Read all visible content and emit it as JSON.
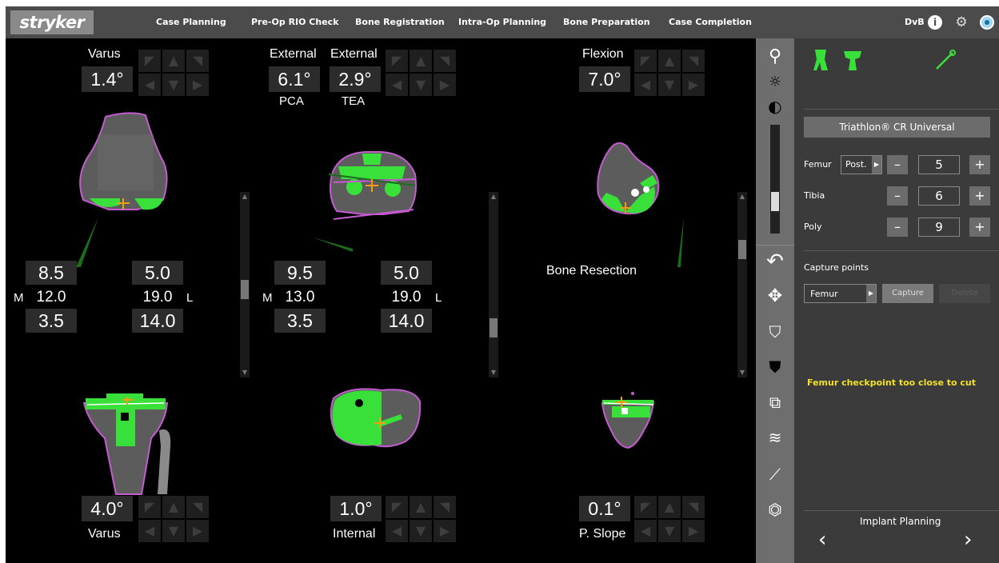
{
  "topbar": {
    "logo": "stryker",
    "tabs": [
      "Case Planning",
      "Pre-Op RIO Check",
      "Bone Registration",
      "Intra-Op Planning",
      "Bone Preparation",
      "Case Completion"
    ],
    "user": "DvB",
    "info_icon": "info-icon",
    "settings_icon": "gear-icon",
    "camera_icon": "camera-icon"
  },
  "views": {
    "top_left": {
      "label": "Varus",
      "value": "1.4°"
    },
    "top_mid": {
      "label_a": "External",
      "value_a": "6.1°",
      "sub_a": "PCA",
      "label_b": "External",
      "value_b": "2.9°",
      "sub_b": "TEA"
    },
    "top_right": {
      "label": "Flexion",
      "value": "7.0°"
    },
    "bottom_left": {
      "label": "Varus",
      "value": "4.0°"
    },
    "bottom_mid": {
      "label": "Internal",
      "value": "1.0°"
    },
    "bottom_right": {
      "label": "P. Slope",
      "value": "0.1°"
    },
    "bone_resection_label": "Bone Resection"
  },
  "gaps": {
    "left": {
      "m_top": "8.5",
      "m_mid": "12.0",
      "m_bot": "3.5",
      "l_top": "5.0",
      "l_mid": "19.0",
      "l_bot": "14.0",
      "m_label": "M",
      "l_label": "L"
    },
    "mid": {
      "m_top": "9.5",
      "m_mid": "13.0",
      "m_bot": "3.5",
      "l_top": "5.0",
      "l_mid": "19.0",
      "l_bot": "14.0",
      "m_label": "M",
      "l_label": "L"
    }
  },
  "toolbar": {
    "tools": [
      "search-icon",
      "brightness-icon",
      "contrast-icon",
      "contrast-slider",
      "undo-icon",
      "move-icon",
      "femur-view-icon",
      "tibia-view-icon",
      "camera-view-icon",
      "implant-view-icon",
      "probe-icon",
      "knee-icon"
    ]
  },
  "panel": {
    "implant_name": "Triathlon® CR Universal",
    "femur_label": "Femur",
    "femur_option": "Post.",
    "femur_value": "5",
    "tibia_label": "Tibia",
    "tibia_value": "6",
    "poly_label": "Poly",
    "poly_value": "9",
    "minus": "–",
    "plus": "+",
    "capture_points_label": "Capture points",
    "capture_target": "Femur",
    "capture_button": "Capture",
    "delete_button": "Delete",
    "warning": "Femur checkpoint too close to cut",
    "footer_title": "Implant Planning",
    "prev": "‹",
    "next": "›",
    "colors": {
      "accent_green": "#39e03a",
      "warning_yellow": "#f2e02a",
      "bone_outline": "#c45bd0"
    }
  },
  "scrollbars": {
    "left_level": 0.45,
    "mid_level": 0.75,
    "right_level": 0.25
  }
}
